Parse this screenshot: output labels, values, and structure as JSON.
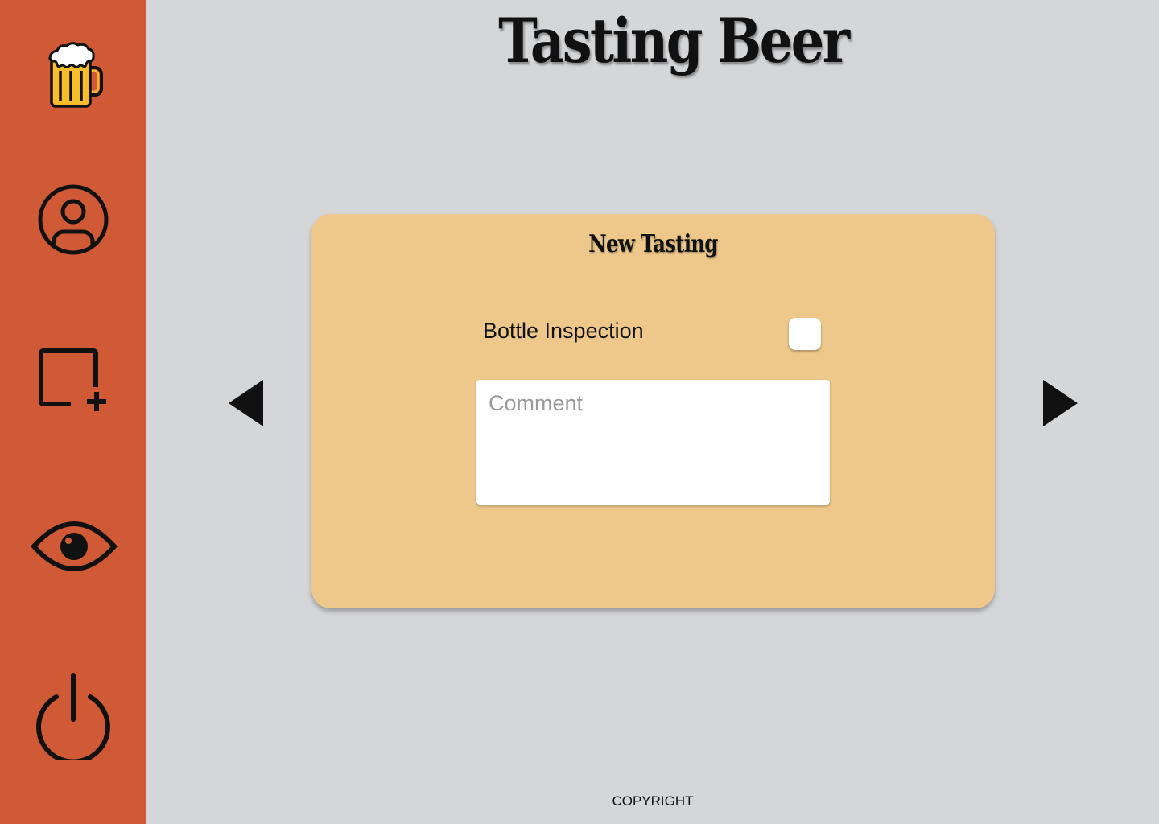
{
  "app": {
    "title": "Tasting Beer"
  },
  "sidebar": {
    "items": [
      {
        "icon": "beer-mug-icon",
        "label": "home"
      },
      {
        "icon": "user-profile-icon",
        "label": "profile"
      },
      {
        "icon": "add-tasting-icon",
        "label": "new tasting"
      },
      {
        "icon": "eye-icon",
        "label": "view tastings"
      },
      {
        "icon": "power-icon",
        "label": "log out"
      }
    ]
  },
  "card": {
    "title": "New Tasting",
    "field_label": "Bottle Inspection",
    "checkbox_checked": false,
    "comment_placeholder": "Comment",
    "comment_value": ""
  },
  "nav": {
    "prev_icon": "triangle-left-icon",
    "next_icon": "triangle-right-icon"
  },
  "footer": {
    "text": "COPYRIGHT"
  },
  "colors": {
    "sidebar": "#d05a35",
    "background": "#d5d6d8",
    "card": "#eec88b",
    "text": "#111111"
  }
}
